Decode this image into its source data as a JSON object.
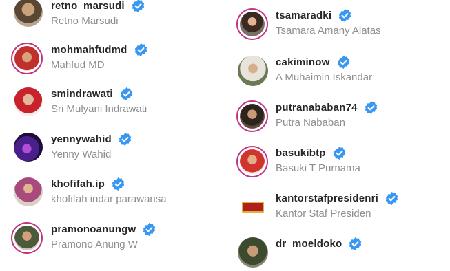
{
  "verified_badge_icon": "verified-badge-icon",
  "colors": {
    "username": "#262626",
    "full_name": "#8e8e8e",
    "verified_blue": "#3897f0",
    "story_ring": "#c13584"
  },
  "left_column": [
    {
      "username": "retno_marsudi",
      "full_name": "Retno Marsudi",
      "verified": true
    },
    {
      "username": "mohmahfudmd",
      "full_name": "Mahfud MD",
      "verified": true
    },
    {
      "username": "smindrawati",
      "full_name": "Sri Mulyani Indrawati",
      "verified": true
    },
    {
      "username": "yennywahid",
      "full_name": "Yenny Wahid",
      "verified": true
    },
    {
      "username": "khofifah.ip",
      "full_name": "khofifah indar parawansa",
      "verified": true
    },
    {
      "username": "pramonoanungw",
      "full_name": "Pramono Anung W",
      "verified": true
    }
  ],
  "right_column": [
    {
      "username": "tsamaradki",
      "full_name": "Tsamara Amany Alatas",
      "verified": true
    },
    {
      "username": "cakiminow",
      "full_name": "A Muhaimin Iskandar",
      "verified": true
    },
    {
      "username": "putranababan74",
      "full_name": "Putra Nababan",
      "verified": true
    },
    {
      "username": "basukibtp",
      "full_name": "Basuki T Purnama",
      "verified": true
    },
    {
      "username": "kantorstafpresidenri",
      "full_name": "Kantor Staf Presiden",
      "verified": true
    },
    {
      "username": "dr_moeldoko",
      "full_name": "",
      "verified": true
    }
  ]
}
